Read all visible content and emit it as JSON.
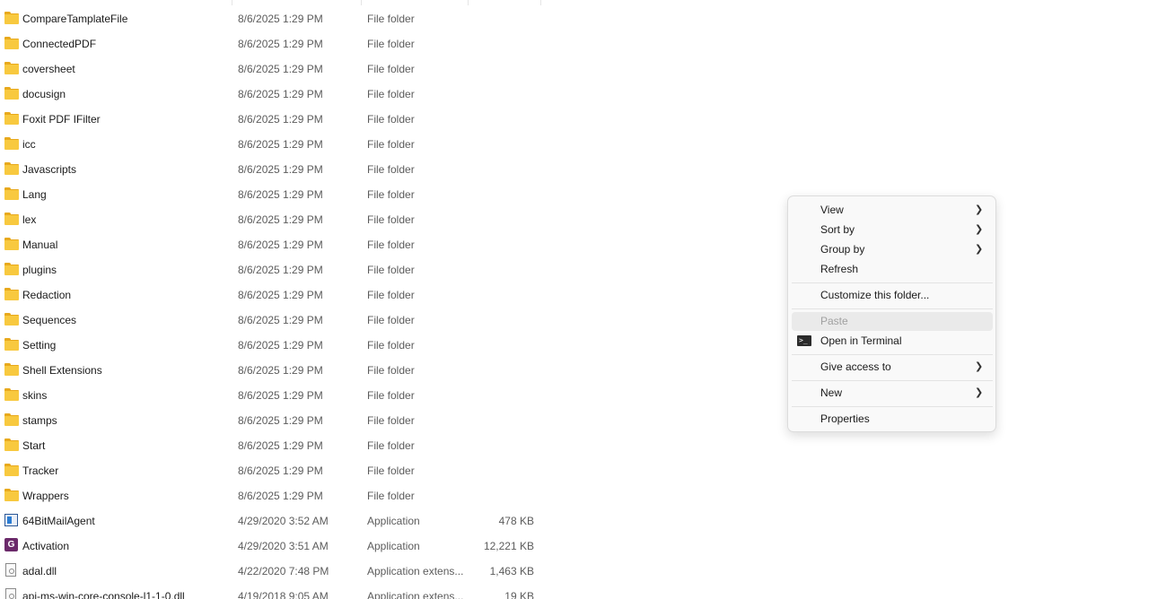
{
  "files": [
    {
      "name": "CompareTamplateFile",
      "date": "8/6/2025 1:29 PM",
      "type": "File folder",
      "size": "",
      "icon": "folder-icon"
    },
    {
      "name": "ConnectedPDF",
      "date": "8/6/2025 1:29 PM",
      "type": "File folder",
      "size": "",
      "icon": "folder-icon"
    },
    {
      "name": "coversheet",
      "date": "8/6/2025 1:29 PM",
      "type": "File folder",
      "size": "",
      "icon": "folder-icon"
    },
    {
      "name": "docusign",
      "date": "8/6/2025 1:29 PM",
      "type": "File folder",
      "size": "",
      "icon": "folder-icon"
    },
    {
      "name": "Foxit PDF IFilter",
      "date": "8/6/2025 1:29 PM",
      "type": "File folder",
      "size": "",
      "icon": "folder-icon"
    },
    {
      "name": "icc",
      "date": "8/6/2025 1:29 PM",
      "type": "File folder",
      "size": "",
      "icon": "folder-icon"
    },
    {
      "name": "Javascripts",
      "date": "8/6/2025 1:29 PM",
      "type": "File folder",
      "size": "",
      "icon": "folder-icon"
    },
    {
      "name": "Lang",
      "date": "8/6/2025 1:29 PM",
      "type": "File folder",
      "size": "",
      "icon": "folder-icon"
    },
    {
      "name": "lex",
      "date": "8/6/2025 1:29 PM",
      "type": "File folder",
      "size": "",
      "icon": "folder-icon"
    },
    {
      "name": "Manual",
      "date": "8/6/2025 1:29 PM",
      "type": "File folder",
      "size": "",
      "icon": "folder-icon"
    },
    {
      "name": "plugins",
      "date": "8/6/2025 1:29 PM",
      "type": "File folder",
      "size": "",
      "icon": "folder-icon"
    },
    {
      "name": "Redaction",
      "date": "8/6/2025 1:29 PM",
      "type": "File folder",
      "size": "",
      "icon": "folder-icon"
    },
    {
      "name": "Sequences",
      "date": "8/6/2025 1:29 PM",
      "type": "File folder",
      "size": "",
      "icon": "folder-icon"
    },
    {
      "name": "Setting",
      "date": "8/6/2025 1:29 PM",
      "type": "File folder",
      "size": "",
      "icon": "folder-icon"
    },
    {
      "name": "Shell Extensions",
      "date": "8/6/2025 1:29 PM",
      "type": "File folder",
      "size": "",
      "icon": "folder-icon"
    },
    {
      "name": "skins",
      "date": "8/6/2025 1:29 PM",
      "type": "File folder",
      "size": "",
      "icon": "folder-icon"
    },
    {
      "name": "stamps",
      "date": "8/6/2025 1:29 PM",
      "type": "File folder",
      "size": "",
      "icon": "folder-icon"
    },
    {
      "name": "Start",
      "date": "8/6/2025 1:29 PM",
      "type": "File folder",
      "size": "",
      "icon": "folder-icon"
    },
    {
      "name": "Tracker",
      "date": "8/6/2025 1:29 PM",
      "type": "File folder",
      "size": "",
      "icon": "folder-icon"
    },
    {
      "name": "Wrappers",
      "date": "8/6/2025 1:29 PM",
      "type": "File folder",
      "size": "",
      "icon": "folder-icon"
    },
    {
      "name": "64BitMailAgent",
      "date": "4/29/2020 3:52 AM",
      "type": "Application",
      "size": "478 KB",
      "icon": "application-icon"
    },
    {
      "name": "Activation",
      "date": "4/29/2020 3:51 AM",
      "type": "Application",
      "size": "12,221 KB",
      "icon": "foxit-activation-icon"
    },
    {
      "name": "adal.dll",
      "date": "4/22/2020 7:48 PM",
      "type": "Application extens...",
      "size": "1,463 KB",
      "icon": "dll-file-icon"
    },
    {
      "name": "api-ms-win-core-console-l1-1-0.dll",
      "date": "4/19/2018 9:05 AM",
      "type": "Application extens...",
      "size": "19 KB",
      "icon": "dll-file-icon"
    }
  ],
  "context_menu": {
    "view": "View",
    "sort_by": "Sort by",
    "group_by": "Group by",
    "refresh": "Refresh",
    "customize": "Customize this folder...",
    "paste": "Paste",
    "open_terminal": "Open in Terminal",
    "give_access": "Give access to",
    "new": "New",
    "properties": "Properties",
    "terminal_glyph": ">_"
  }
}
